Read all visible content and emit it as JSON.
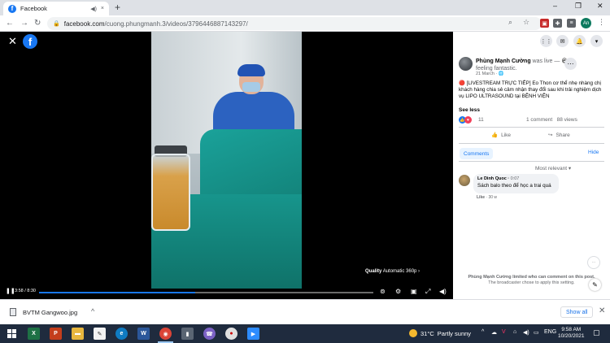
{
  "browser": {
    "tab_title": "Facebook",
    "tab_close": "×",
    "url_host": "facebook.com",
    "url_path": "/cuong.phungmanh.3/videos/3796446887143297/",
    "profile_initials": "An"
  },
  "video": {
    "time": "3:58 / 8:30",
    "progress_fraction": 0.467,
    "quality_label": "Quality",
    "quality_value": "Automatic 360p"
  },
  "post": {
    "author_name": "Phùng Mạnh Cường",
    "status": "was live —",
    "feeling": "feeling fantastic.",
    "date": "21 March",
    "text": "[LIVESTREAM TRỰC TIẾP] Eo Thon cơ thể nhẹ nhàng chị khách hàng chia sẻ cảm nhận thay đổi sau khi trải nghiệm dịch vụ LIPO ULTRASOUND tại BỆNH VIỆN",
    "see_less": "See less",
    "reaction_count": "11",
    "comment_count": "1 comment",
    "view_count": "88 views",
    "like_label": "Like",
    "share_label": "Share",
    "comments_tab": "Comments",
    "hide_label": "Hide",
    "sort_label": "Most relevant"
  },
  "comment": {
    "name": "Le Dinh Quoc",
    "time": "0:07",
    "text": "Sách balo theo để học a trai quá",
    "like_label": "Like",
    "age": "30 w"
  },
  "restriction": {
    "line1": "Phùng Mạnh Cường limited who can comment on this post.",
    "line2": "The broadcaster chose to apply this setting."
  },
  "download": {
    "file_name": "BVTM Gangwoo.jpg",
    "show_all": "Show all"
  },
  "taskbar": {
    "temperature": "31°C",
    "weather": "Partly sunny",
    "language": "ENG",
    "time": "9:58 AM",
    "date": "10/20/2021"
  },
  "colors": {
    "fb_blue": "#1877f2",
    "drape_green": "#128077",
    "taskbar": "#1f2b3e"
  }
}
